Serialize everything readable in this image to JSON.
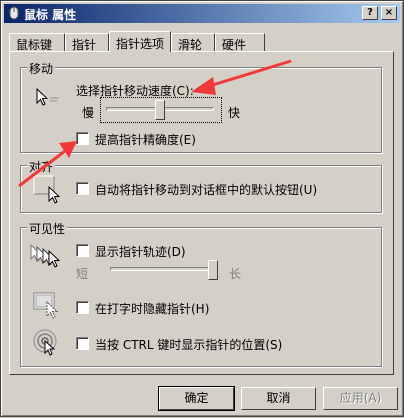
{
  "window": {
    "title": "鼠标 属性",
    "help_button": "?",
    "close_button": "×"
  },
  "tabs": [
    {
      "label": "鼠标键"
    },
    {
      "label": "指针"
    },
    {
      "label": "指针选项"
    },
    {
      "label": "滑轮"
    },
    {
      "label": "硬件"
    }
  ],
  "motion": {
    "group_label": "移动",
    "speed_label": "选择指针移动速度(C):",
    "slow_label": "慢",
    "fast_label": "快",
    "speed_value": 0.5,
    "precision_label": "提高指针精确度(E)",
    "precision_checked": false
  },
  "snap": {
    "group_label": "对齐",
    "snap_label": "自动将指针移动到对话框中的默认按钮(U)",
    "snap_checked": false
  },
  "visibility": {
    "group_label": "可见性",
    "trails_label": "显示指针轨迹(D)",
    "trails_checked": false,
    "short_label": "短",
    "long_label": "长",
    "trail_length": 1.0,
    "hide_label": "在打字时隐藏指针(H)",
    "hide_checked": false,
    "ctrl_label": "当按 CTRL 键时显示指针的位置(S)",
    "ctrl_checked": false
  },
  "buttons": {
    "ok": "确定",
    "cancel": "取消",
    "apply": "应用(A)"
  },
  "colors": {
    "annotation_arrow": "#f03a3a"
  }
}
